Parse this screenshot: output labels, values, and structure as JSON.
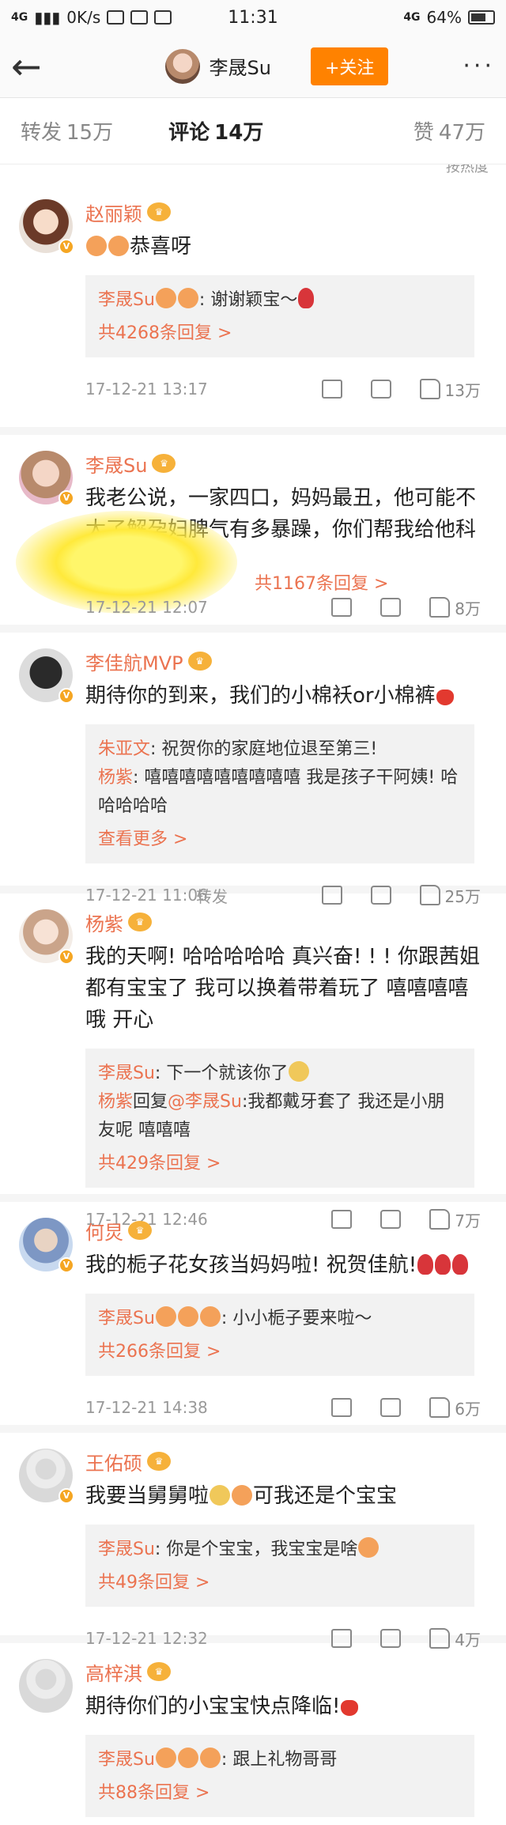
{
  "status": {
    "network": "4G",
    "speed": "0K/s",
    "time": "11:31",
    "network_right": "4G",
    "battery": "64%"
  },
  "nav": {
    "back_icon": "back-arrow-icon",
    "title": "李晟Su",
    "follow_label": "+关注",
    "more_label": "···"
  },
  "tabs": {
    "repost_label": "转发",
    "repost_count": "15万",
    "comment_label": "评论",
    "comment_count": "14万",
    "like_label": "赞",
    "like_count": "47万"
  },
  "sort_hint": "按热度",
  "colors": {
    "accent": "#ff8200",
    "name": "#eb7350"
  },
  "comments": [
    {
      "name": "赵丽颖",
      "text": "恭喜呀",
      "reply_name": "李晟Su",
      "reply_text": ": 谢谢颖宝～",
      "reply_more": "共4268条回复 >",
      "time": "17-12-21 13:17",
      "likes": "13万"
    },
    {
      "name": "李晟Su",
      "text": "我老公说，一家四口，妈妈最丑，他可能不太了解孕妇脾气有多暴躁，你们帮我给他科普一下",
      "reply_more": "共1167条回复 >",
      "time": "17-12-21 12:07",
      "likes": "8万"
    },
    {
      "name": "李佳航MVP",
      "text": "期待你的到来，我们的小棉袄or小棉裤",
      "reply1_name": "朱亚文",
      "reply1_text": ": 祝贺你的家庭地位退至第三!",
      "reply2_name": "杨紫",
      "reply2_text": ": 嘻嘻嘻嘻嘻嘻嘻嘻嘻 我是孩子干阿姨! 哈哈哈哈哈",
      "reply_more": "查看更多 >",
      "time": "17-12-21 11:06",
      "repost": "转发",
      "likes": "25万"
    },
    {
      "name": "杨紫",
      "text": "我的天啊! 哈哈哈哈哈 真兴奋! ! ! 你跟茜姐都有宝宝了 我可以换着带着玩了 嘻嘻嘻嘻哦 开心",
      "reply1_name": "李晟Su",
      "reply1_text": ": 下一个就该你了",
      "reply2_name": "杨紫",
      "reply2_mid": "回复",
      "reply2_at": "@李晟Su",
      "reply2_text": ":我都戴牙套了 我还是小朋友呢 嘻嘻嘻",
      "reply_more": "共429条回复 >",
      "time": "17-12-21 12:46",
      "likes": "7万"
    },
    {
      "name": "何炅",
      "text": "我的栀子花女孩当妈妈啦! 祝贺佳航!",
      "reply_name": "李晟Su",
      "reply_text": ": 小小栀子要来啦～",
      "reply_more": "共266条回复 >",
      "time": "17-12-21 14:38",
      "likes": "6万"
    },
    {
      "name": "王佑硕",
      "text": "我要当舅舅啦",
      "text2": "可我还是个宝宝",
      "reply_name": "李晟Su",
      "reply_text": ": 你是个宝宝，我宝宝是啥",
      "reply_more": "共49条回复 >",
      "time": "17-12-21 12:32",
      "likes": "4万"
    },
    {
      "name": "高梓淇",
      "text": "期待你们的小宝宝快点降临!",
      "reply_name": "李晟Su",
      "reply_text": ": 跟上礼物哥哥",
      "reply_more": "共88条回复 >"
    }
  ]
}
